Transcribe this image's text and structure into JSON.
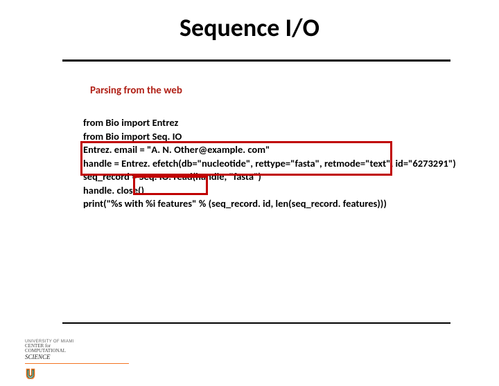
{
  "title": "Sequence I/O",
  "subtitle": "Parsing from the web",
  "code": "from Bio import Entrez\nfrom Bio import Seq. IO\nEntrez. email = \"A. N. Other@example. com\"\nhandle = Entrez. efetch(db=\"nucleotide\", rettype=\"fasta\", retmode=\"text\", id=\"6273291\")\nseq_record = Seq. IO. read(handle, \"fasta\")\nhandle. close()\nprint(\"%s with %i features\" % (seq_record. id, len(seq_record. features)))",
  "footer": {
    "univ": "UNIVERSITY OF MIAMI",
    "center1": "CENTER for",
    "center2": "COMPUTATIONAL",
    "center3": "SCIENCE"
  }
}
